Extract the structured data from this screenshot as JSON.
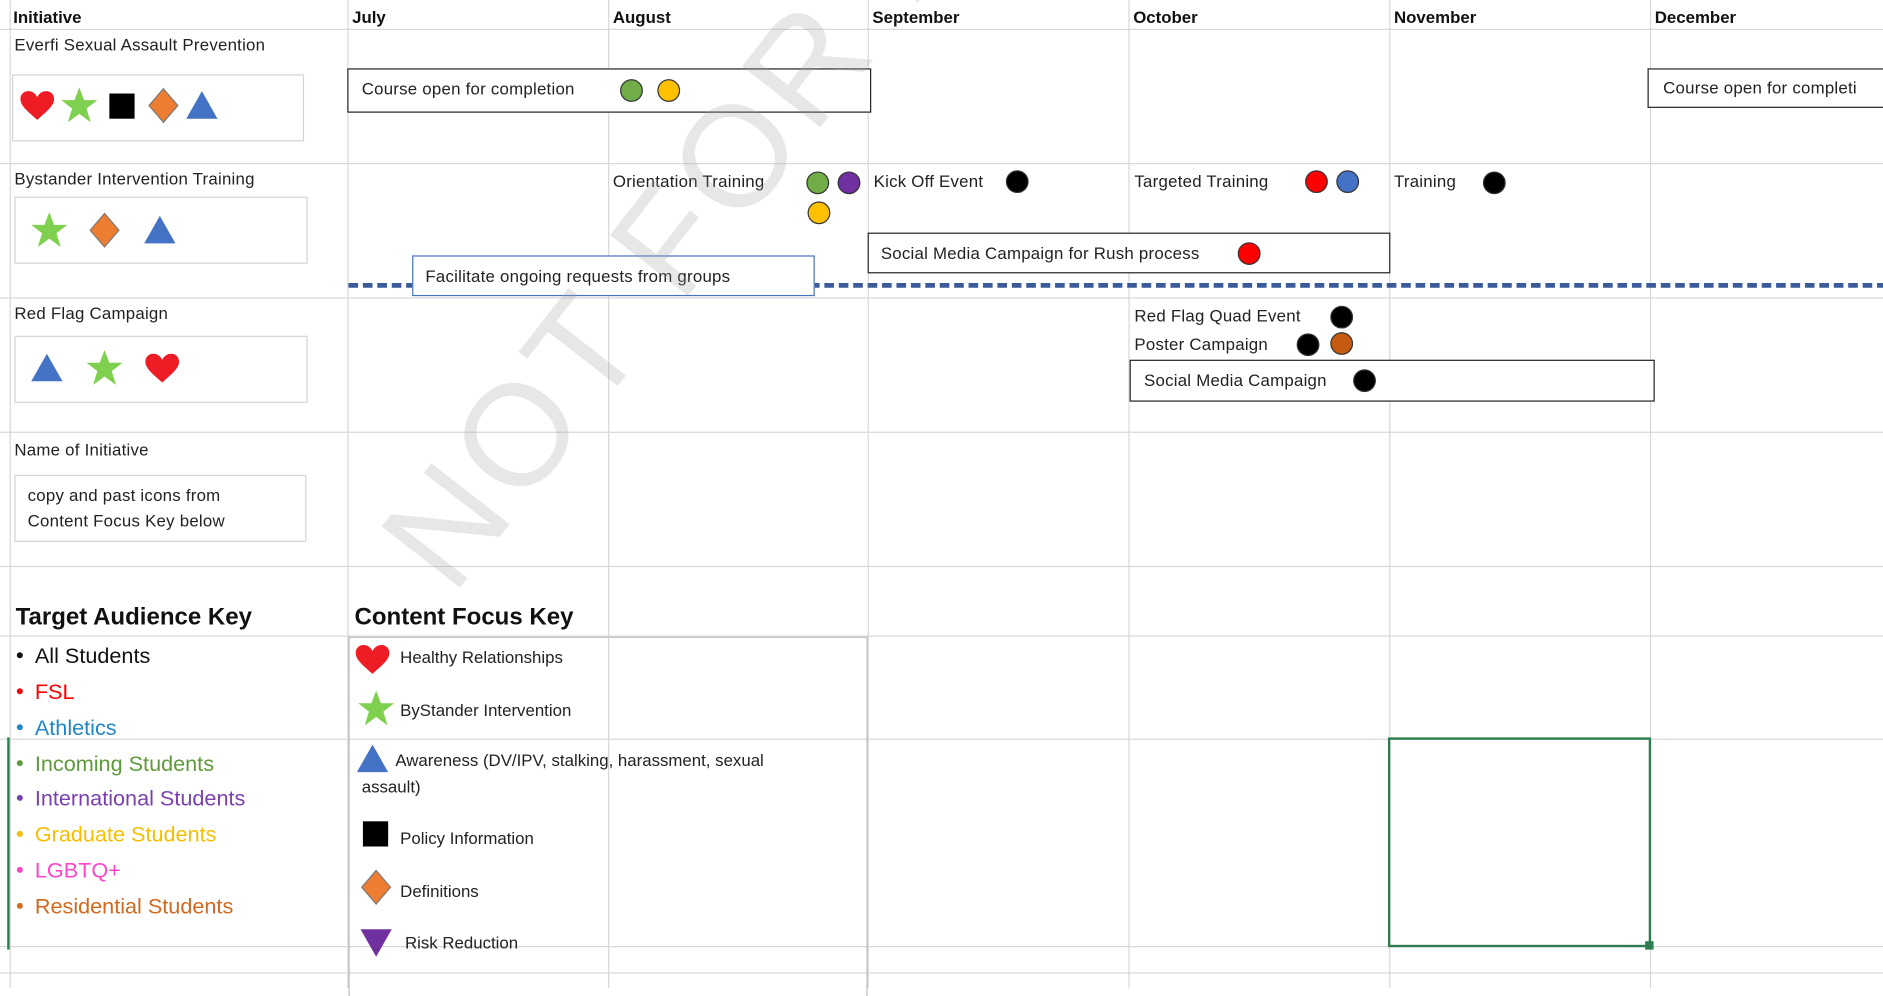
{
  "header": {
    "initiative": "Initiative",
    "months": [
      "July",
      "August",
      "September",
      "October",
      "November",
      "December"
    ]
  },
  "rows": {
    "everfi": {
      "name": "Everfi Sexual Assault Prevention",
      "course_label_1": "Course open for completion",
      "course_label_2": "Course open for completi"
    },
    "bystander": {
      "name": "Bystander Intervention Training",
      "orientation": "Orientation Training",
      "kickoff": "Kick Off Event",
      "targeted": "Targeted Training",
      "training": "Training",
      "social_rush": "Social Media Campaign for Rush process",
      "facilitate": "Facilitate ongoing requests from groups"
    },
    "redflag": {
      "name": "Red Flag Campaign",
      "quad": "Red Flag Quad Event",
      "poster": "Poster Campaign",
      "social": "Social Media Campaign"
    },
    "template": {
      "name": "Name of Initiative",
      "note_line1": "copy and past icons from",
      "note_line2": "Content Focus Key below"
    }
  },
  "target_audience_key": {
    "title": "Target Audience Key",
    "items": [
      {
        "label": "All Students",
        "color": "#111111"
      },
      {
        "label": "FSL",
        "color": "#ff0000"
      },
      {
        "label": "Athletics",
        "color": "#1f86c8"
      },
      {
        "label": "Incoming Students",
        "color": "#5f9a3a"
      },
      {
        "label": "International Students",
        "color": "#7a3fb0"
      },
      {
        "label": "Graduate Students",
        "color": "#f6be00"
      },
      {
        "label": "LGBTQ+",
        "color": "#ff44cc"
      },
      {
        "label": "Residential Students",
        "color": "#d2691e"
      }
    ]
  },
  "content_focus_key": {
    "title": "Content Focus Key",
    "items": [
      {
        "label": "Healthy Relationships",
        "icon": "heart-icon"
      },
      {
        "label": "ByStander Intervention",
        "icon": "star-icon"
      },
      {
        "label": "Awareness (DV/IPV, stalking, harassment, sexual",
        "label2": "assault)",
        "icon": "triangle-icon"
      },
      {
        "label": "Policy Information",
        "icon": "square-icon"
      },
      {
        "label": "Definitions",
        "icon": "diamond-icon"
      },
      {
        "label": "Risk Reduction",
        "icon": "triangle-down-icon"
      }
    ]
  },
  "watermark": "NOT FOR DISTRIBUTION",
  "colors": {
    "heart": "#ee1c24",
    "star": "#7ed04e",
    "square": "#000000",
    "diamond": "#ed7d31",
    "triangle": "#4472c4",
    "risk": "#7030a0",
    "dot_green": "#70ad47",
    "dot_yellow": "#ffc000",
    "dot_purple": "#7030a0",
    "dot_black": "#000000",
    "dot_red": "#ff0000",
    "dot_blue": "#4472c4",
    "dot_orange": "#c55a11",
    "dashed_line": "#3a5a9a",
    "selection": "#2e7d4f"
  }
}
